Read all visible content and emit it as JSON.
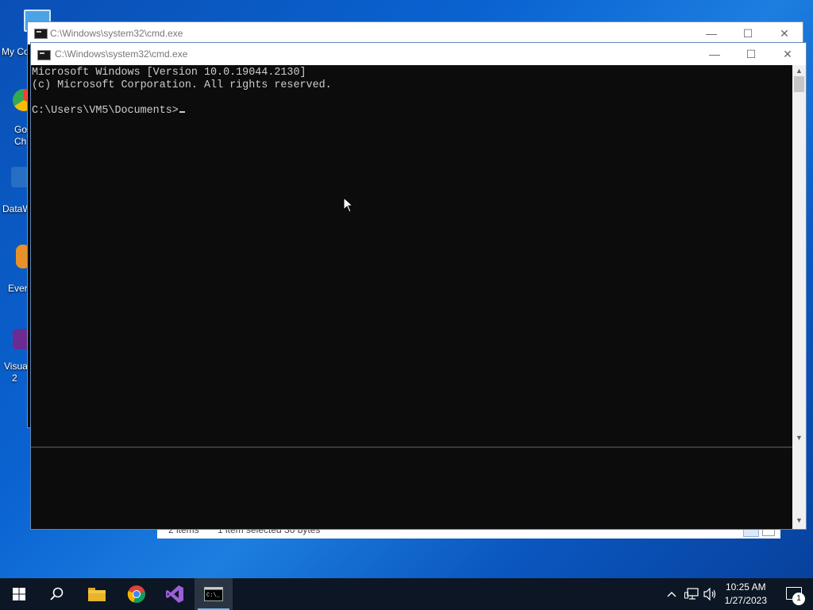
{
  "desktop": {
    "icons": [
      {
        "label": "My Co",
        "name": "my-computer"
      },
      {
        "label": "Go\nCh",
        "name": "google-chrome"
      },
      {
        "label": "DataW",
        "name": "datawrapper"
      },
      {
        "label": "Ever",
        "name": "evernote"
      },
      {
        "label": "Visua\n2",
        "name": "visual-studio"
      }
    ]
  },
  "back_window": {
    "title": "C:\\Windows\\system32\\cmd.exe",
    "controls": {
      "min": "—",
      "max": "☐",
      "close": "✕"
    }
  },
  "cmd_window": {
    "title": "C:\\Windows\\system32\\cmd.exe",
    "controls": {
      "min": "—",
      "max": "☐",
      "close": "✕"
    },
    "lines": [
      "Microsoft Windows [Version 10.0.19044.2130]",
      "(c) Microsoft Corporation. All rights reserved.",
      "",
      "C:\\Users\\VM5\\Documents>"
    ]
  },
  "explorer_status": {
    "items": "2 items",
    "selected": "1 item selected  30 bytes"
  },
  "taskbar": {
    "apps": [
      {
        "name": "start-button",
        "icon": "windows-logo-icon"
      },
      {
        "name": "search-button",
        "icon": "search-icon"
      },
      {
        "name": "file-explorer",
        "icon": "folder-icon"
      },
      {
        "name": "chrome",
        "icon": "chrome-icon"
      },
      {
        "name": "visual-studio",
        "icon": "visual-studio-icon"
      },
      {
        "name": "command-prompt",
        "icon": "cmd-icon"
      }
    ],
    "time": "10:25 AM",
    "date": "1/27/2023",
    "notification_count": "1"
  },
  "colors": {
    "console_bg": "#0c0c0c",
    "console_fg": "#cccccc",
    "taskbar_bg": "#0c1624",
    "accent": "#76b9ed"
  }
}
